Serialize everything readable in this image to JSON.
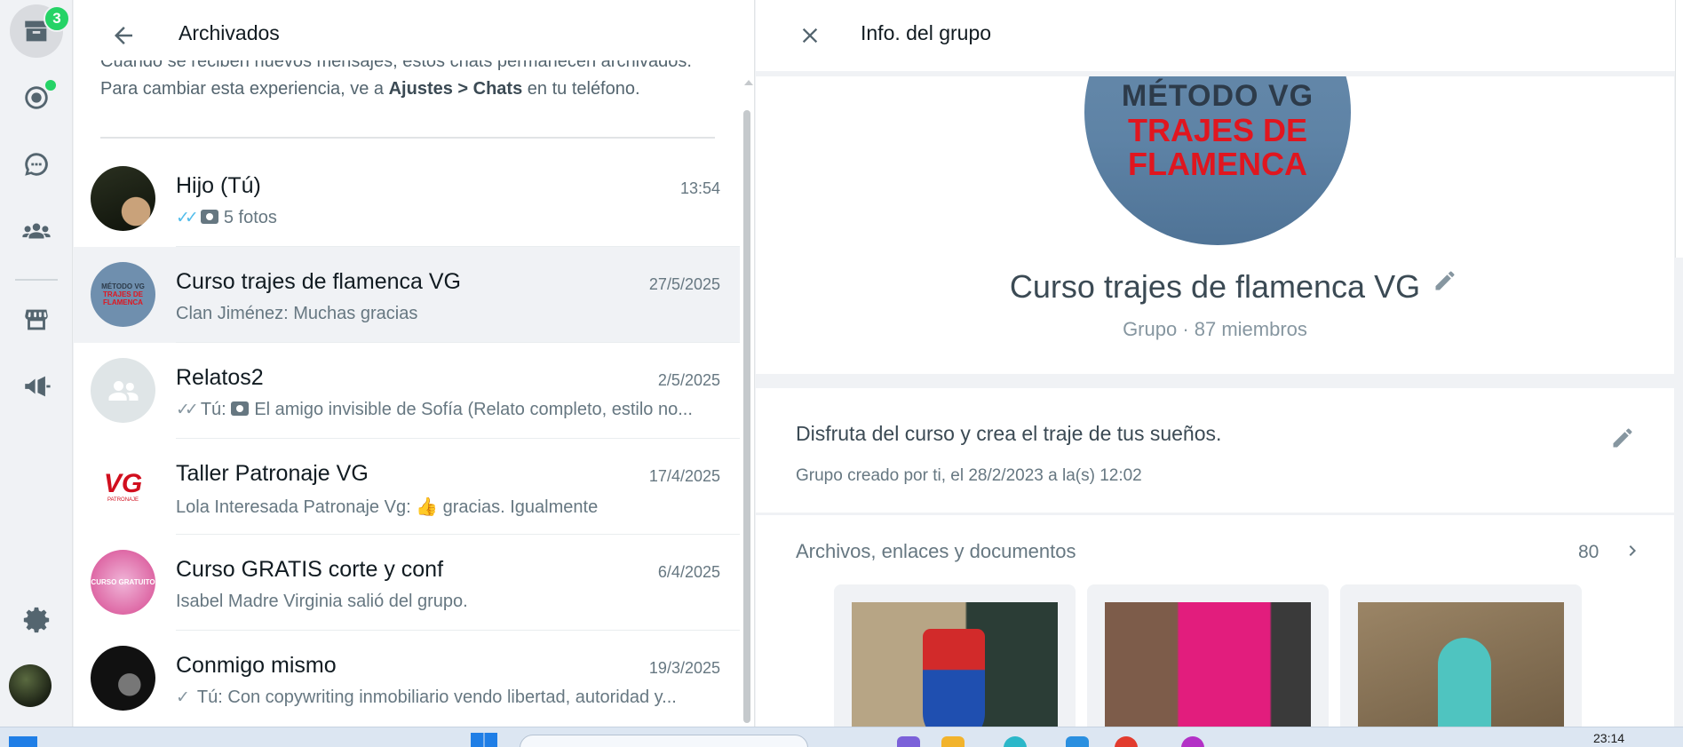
{
  "rail": {
    "archived_badge": "3"
  },
  "archived": {
    "title": "Archivados",
    "info_line1": "Cuando se reciben nuevos mensajes, estos chats permanecen archivados.",
    "info_line2_pre": "Para cambiar esta experiencia, ve a ",
    "info_line2_bold": "Ajustes > Chats",
    "info_line2_post": " en tu teléfono.",
    "chats": [
      {
        "name": "Hijo (Tú)",
        "time": "13:54",
        "preview": "5 fotos",
        "prefix": ""
      },
      {
        "name": "Curso trajes de flamenca VG",
        "time": "27/5/2025",
        "preview": "Clan Jiménez: Muchas gracias",
        "prefix": ""
      },
      {
        "name": "Relatos2",
        "time": "2/5/2025",
        "preview": "El amigo invisible de Sofía (Relato completo, estilo no...",
        "prefix": "Tú:"
      },
      {
        "name": "Taller Patronaje VG",
        "time": "17/4/2025",
        "preview": "Lola Interesada Patronaje Vg: 👍 gracias. Igualmente",
        "prefix": ""
      },
      {
        "name": "Curso GRATIS corte y conf",
        "time": "6/4/2025",
        "preview": "Isabel Madre Virginia salió del grupo.",
        "prefix": ""
      },
      {
        "name": "Conmigo mismo",
        "time": "19/3/2025",
        "preview": "Con copywriting inmobiliario vendo libertad, autoridad y...",
        "prefix": "Tú:"
      }
    ],
    "avatar_text": {
      "curso_line1": "MÉTODO VG",
      "curso_line2": "TRAJES DE",
      "curso_line3": "FLAMENCA",
      "taller_logo": "VG",
      "taller_sub": "PATRONAJE",
      "gratis_text": "CURSO GRATUITO"
    }
  },
  "info": {
    "title": "Info. del grupo",
    "photo_line1": "MÉTODO VG",
    "photo_line2": "TRAJES DE",
    "photo_line3": "FLAMENCA",
    "group_name": "Curso trajes de flamenca VG",
    "group_meta": "Grupo · 87 miembros",
    "description": "Disfruta del curso y crea el traje de tus sueños.",
    "created": "Grupo creado por ti, el 28/2/2023 a la(s) 12:02",
    "media_title": "Archivos, enlaces y documentos",
    "media_count": "80"
  },
  "taskbar": {
    "time": "23:14"
  },
  "colors": {
    "accent_green": "#25d366",
    "read_ticks": "#53bdeb",
    "brand_red": "#e0161f"
  }
}
